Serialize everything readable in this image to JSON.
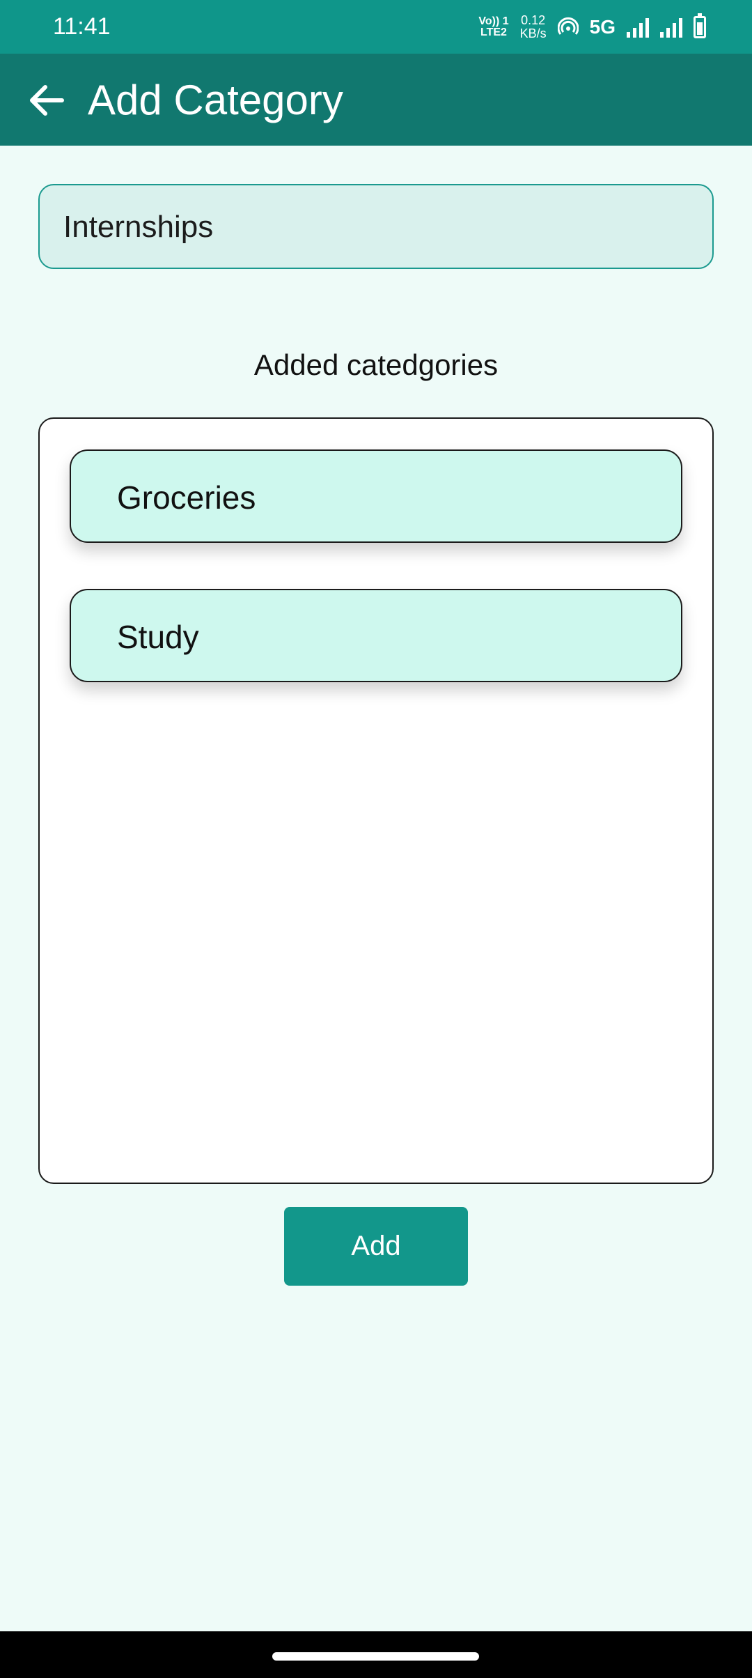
{
  "status_bar": {
    "time": "11:41",
    "volte_top": "Vo)) 1",
    "volte_bottom": "LTE2",
    "speed_value": "0.12",
    "speed_unit": "KB/s",
    "network": "5G"
  },
  "app_bar": {
    "title": "Add Category",
    "back_icon": "arrow-left-icon"
  },
  "input": {
    "value": "Internships"
  },
  "section": {
    "heading": "Added catedgories"
  },
  "categories": [
    {
      "label": "Groceries"
    },
    {
      "label": "Study"
    }
  ],
  "actions": {
    "add_label": "Add"
  },
  "colors": {
    "status_bar": "#0f968a",
    "app_bar": "#11786f",
    "background": "#eefbf8",
    "card": "#cef8ee",
    "button": "#12978b"
  }
}
